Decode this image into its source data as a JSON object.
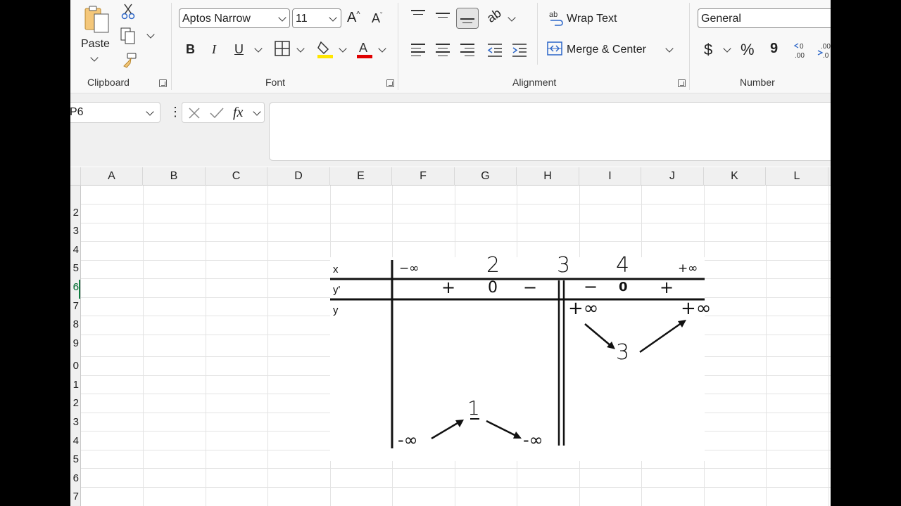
{
  "ribbon": {
    "clipboard": {
      "paste_label": "Paste",
      "group_label": "Clipboard"
    },
    "font": {
      "font_name": "Aptos Narrow",
      "font_size": "11",
      "bold": "B",
      "italic": "I",
      "underline": "U",
      "fill_color": "#ffe600",
      "font_color": "#e00000",
      "group_label": "Font"
    },
    "alignment": {
      "wrap_text": "Wrap Text",
      "merge_center": "Merge & Center",
      "group_label": "Alignment"
    },
    "number": {
      "format": "General",
      "currency": "$",
      "percent": "%",
      "comma": "9",
      "group_label": "Number"
    }
  },
  "formula_bar": {
    "name_box": "P6",
    "fx": "fx",
    "content": ""
  },
  "columns": [
    "A",
    "B",
    "C",
    "D",
    "E",
    "F",
    "G",
    "H",
    "I",
    "J",
    "K",
    "L"
  ],
  "rows": [
    "2",
    "3",
    "4",
    "5",
    "6",
    "7",
    "8",
    "9",
    "0",
    "1",
    "2",
    "3",
    "4",
    "5",
    "6",
    "7"
  ],
  "table": {
    "x_label": "x",
    "yprime_label": "y'",
    "y_label": "y",
    "x_values": [
      "−∞",
      "2",
      "3",
      "4",
      "+∞"
    ],
    "yprime_signs": [
      "+",
      "0",
      "−",
      "−",
      "0",
      "+"
    ],
    "y_values": [
      "-∞",
      "1",
      "-∞",
      "+∞",
      "3",
      "+∞"
    ]
  }
}
